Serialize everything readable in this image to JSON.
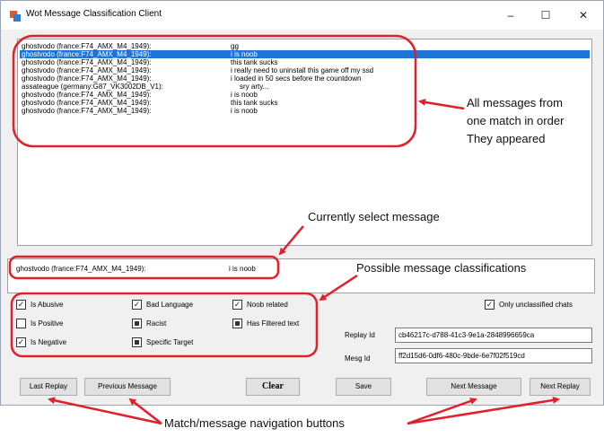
{
  "window": {
    "title": "Wot Message Classification Client",
    "controls": {
      "minimize": "–",
      "maximize": "☐",
      "close": "✕"
    }
  },
  "messages": [
    {
      "sender": "ghostvodo (france:F74_AMX_M4_1949):",
      "text": "gg"
    },
    {
      "sender": "ghostvodo (france:F74_AMX_M4_1949):",
      "text": "i is noob",
      "selected": true
    },
    {
      "sender": "ghostvodo (france:F74_AMX_M4_1949):",
      "text": "this tank sucks"
    },
    {
      "sender": "ghostvodo (france:F74_AMX_M4_1949):",
      "text": "i really need to uninstall this game off my ssd"
    },
    {
      "sender": "ghostvodo (france:F74_AMX_M4_1949):",
      "text": "i loaded in 50 secs before the countdown"
    },
    {
      "sender": "assateague (germany:G87_VK3002DB_V1):",
      "text": "sry arty..."
    },
    {
      "sender": "ghostvodo (france:F74_AMX_M4_1949):",
      "text": "i is noob"
    },
    {
      "sender": "ghostvodo (france:F74_AMX_M4_1949):",
      "text": "this tank sucks"
    },
    {
      "sender": "ghostvodo (france:F74_AMX_M4_1949):",
      "text": "i is noob"
    }
  ],
  "selected_message": {
    "sender": "ghostvodo (france:F74_AMX_M4_1949):",
    "text": "i is noob"
  },
  "classifications": {
    "is_abusive": {
      "label": "Is Abusive",
      "state": "checked"
    },
    "is_positive": {
      "label": "Is Positive",
      "state": "unchecked"
    },
    "is_negative": {
      "label": "Is Negative",
      "state": "checked"
    },
    "bad_language": {
      "label": "Bad Language",
      "state": "checked"
    },
    "racist": {
      "label": "Racist",
      "state": "indeterminate"
    },
    "specific_target": {
      "label": "Specific Target",
      "state": "indeterminate"
    },
    "noob_related": {
      "label": "Noob related",
      "state": "checked"
    },
    "has_filtered_text": {
      "label": "Has Filtered text",
      "state": "indeterminate"
    }
  },
  "only_unclassified": {
    "label": "Only unclassified chats",
    "state": "checked"
  },
  "replay_id": {
    "label": "Replay Id",
    "value": "cb46217c-d788-41c3-9e1a-2848996659ca"
  },
  "mesg_id": {
    "label": "Mesg Id",
    "value": "ff2d15d6-0df6-480c-9bde-6e7f02f519cd"
  },
  "buttons": {
    "last_replay": "Last Replay",
    "previous_message": "Previous Message",
    "clear": "Clear",
    "save": "Save",
    "next_message": "Next Message",
    "next_replay": "Next Replay"
  },
  "annotations": {
    "all_messages": [
      "All messages from",
      "one match in order",
      "They appeared"
    ],
    "current_message": "Currently select message",
    "classifications": "Possible message classifications",
    "navigation": "Match/message navigation buttons"
  },
  "colors": {
    "annotation_red": "#e0202a",
    "selection_blue": "#1e74d6"
  }
}
